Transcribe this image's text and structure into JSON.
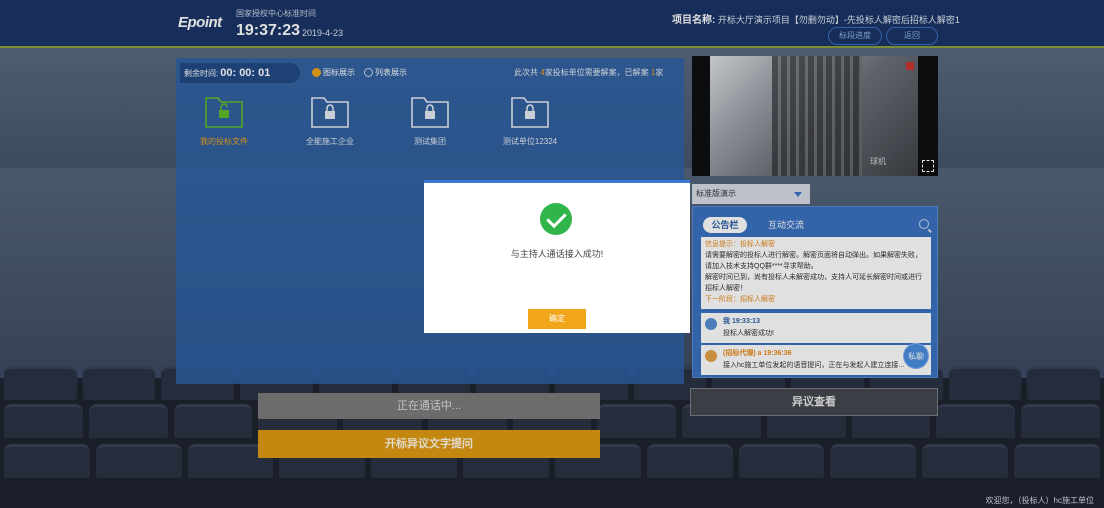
{
  "header": {
    "logo": "Epoint",
    "time_label": "国家授权中心标准时间",
    "time": "19:37:23",
    "date": "2019-4-23",
    "project_label": "项目名称:",
    "project_name": "开标大厅演示项目【勿删勿动】-先投标人解密后招标人解密1",
    "progress_button": "标段进度",
    "back_button": "返回"
  },
  "left_panel": {
    "remaining_label": "剩余时间:",
    "remaining_time": "00: 00: 01",
    "view_icon": "图标展示",
    "view_list": "列表展示",
    "decrypt_prefix": "此次共",
    "decrypt_total": "4",
    "decrypt_mid": "家投标单位需要解案，已解案",
    "decrypt_done": "1",
    "decrypt_suffix": "家",
    "folders": [
      {
        "label": "我的投标文件"
      },
      {
        "label": "全能施工企业"
      },
      {
        "label": "测试集团"
      },
      {
        "label": "测试单位12324"
      }
    ]
  },
  "video": {
    "camera_label": "球机"
  },
  "dropdown": {
    "selected": "标准版演示"
  },
  "board": {
    "tab_notice": "公告栏",
    "tab_interact": "互动交流",
    "notice_top": "信息提示：投标人解密",
    "notice_lines": [
      "请需要解密的投标人进行解密。解密页面将自动弹出。如果解密失败，请加入技术支持QQ群****寻求帮助。",
      "解密时间已到，尚有投标人未解密成功，支持人可延长解密时间或进行招标人解密！"
    ],
    "notice_next": "下一阶段：招标人解密",
    "msg1_who": "我 19:33:13",
    "msg1_text": "投标人解密成功!",
    "msg2_role": "(招标代理)",
    "msg2_who": "a 19:36:36",
    "msg2_text": "接入hc施工单位发起的语音提问，正在与发起人建立连接...",
    "private_button": "私聊"
  },
  "buttons": {
    "calling": "正在通话中...",
    "text_question": "开标异议文字提问",
    "objection_view": "异议查看"
  },
  "footer": "欢迎您，（投标人）hc施工单位",
  "dialog": {
    "message": "与主持人通话接入成功!",
    "confirm": "确定"
  },
  "colors": {
    "accent": "#f0a51a",
    "brand": "#1a3566",
    "success": "#2fb54a"
  }
}
